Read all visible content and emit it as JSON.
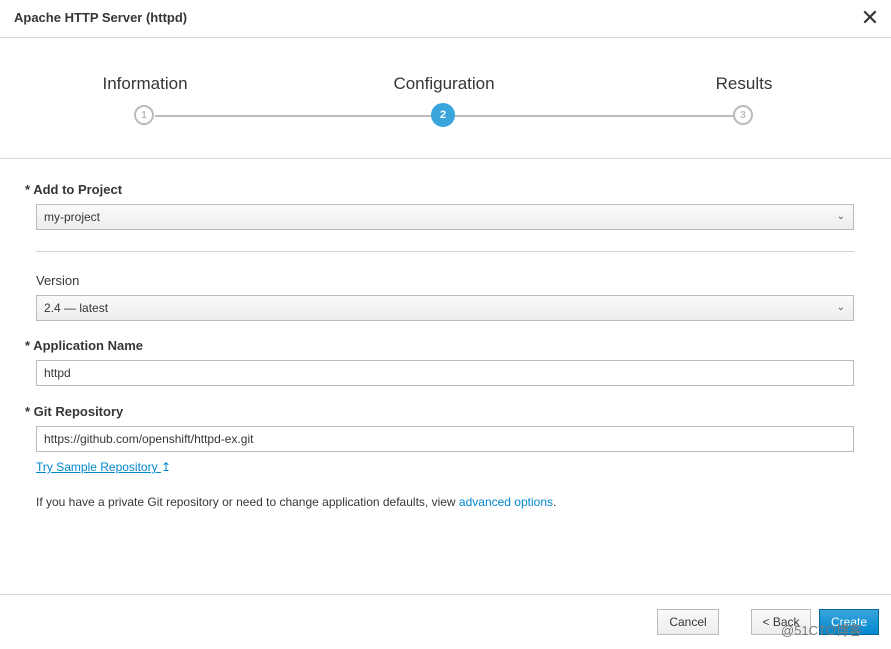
{
  "dialog": {
    "title": "Apache HTTP Server (httpd)",
    "close_glyph": "✕"
  },
  "wizard": {
    "steps": [
      {
        "label": "Information",
        "number": "1",
        "state": "done"
      },
      {
        "label": "Configuration",
        "number": "2",
        "state": "active"
      },
      {
        "label": "Results",
        "number": "3",
        "state": "pending"
      }
    ]
  },
  "form": {
    "project": {
      "label": "* Add to Project",
      "value": "my-project"
    },
    "version": {
      "label": "Version",
      "value": "2.4 — latest"
    },
    "app_name": {
      "label": "* Application Name",
      "value": "httpd"
    },
    "git_repo": {
      "label": "* Git Repository",
      "value": "https://github.com/openshift/httpd-ex.git"
    },
    "sample_link": "Try Sample Repository",
    "sample_link_icon": "↥",
    "help_prefix": "If you have a private Git repository or need to change application defaults, view ",
    "help_link": "advanced options",
    "help_suffix": "."
  },
  "footer": {
    "cancel_label": "Cancel",
    "back_label": "< Back",
    "create_label": "Create"
  },
  "watermark": "@51CTO博客",
  "colors": {
    "accent": "#39a5dc",
    "link": "#0088ce"
  }
}
